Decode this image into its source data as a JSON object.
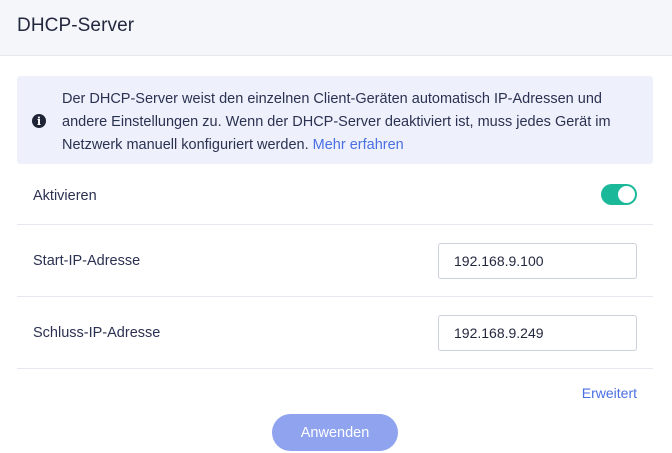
{
  "header": {
    "title": "DHCP-Server"
  },
  "info": {
    "icon": "info-icon",
    "text": "Der DHCP-Server weist den einzelnen Client-Geräten automatisch IP-Adressen und andere Einstellungen zu. Wenn der DHCP-Server deaktiviert ist, muss jedes Gerät im Netzwerk manuell konfiguriert werden. ",
    "link_label": "Mehr erfahren"
  },
  "activate": {
    "label": "Aktivieren",
    "enabled": true
  },
  "start_ip": {
    "label": "Start-IP-Adresse",
    "value": "192.168.9.100"
  },
  "end_ip": {
    "label": "Schluss-IP-Adresse",
    "value": "192.168.9.249"
  },
  "advanced": {
    "label": "Erweitert"
  },
  "apply": {
    "label": "Anwenden"
  },
  "colors": {
    "accent_link": "#4a6fe3",
    "toggle_on": "#1bb99a",
    "button": "#8fa3ee",
    "info_background": "#eef1fb"
  }
}
